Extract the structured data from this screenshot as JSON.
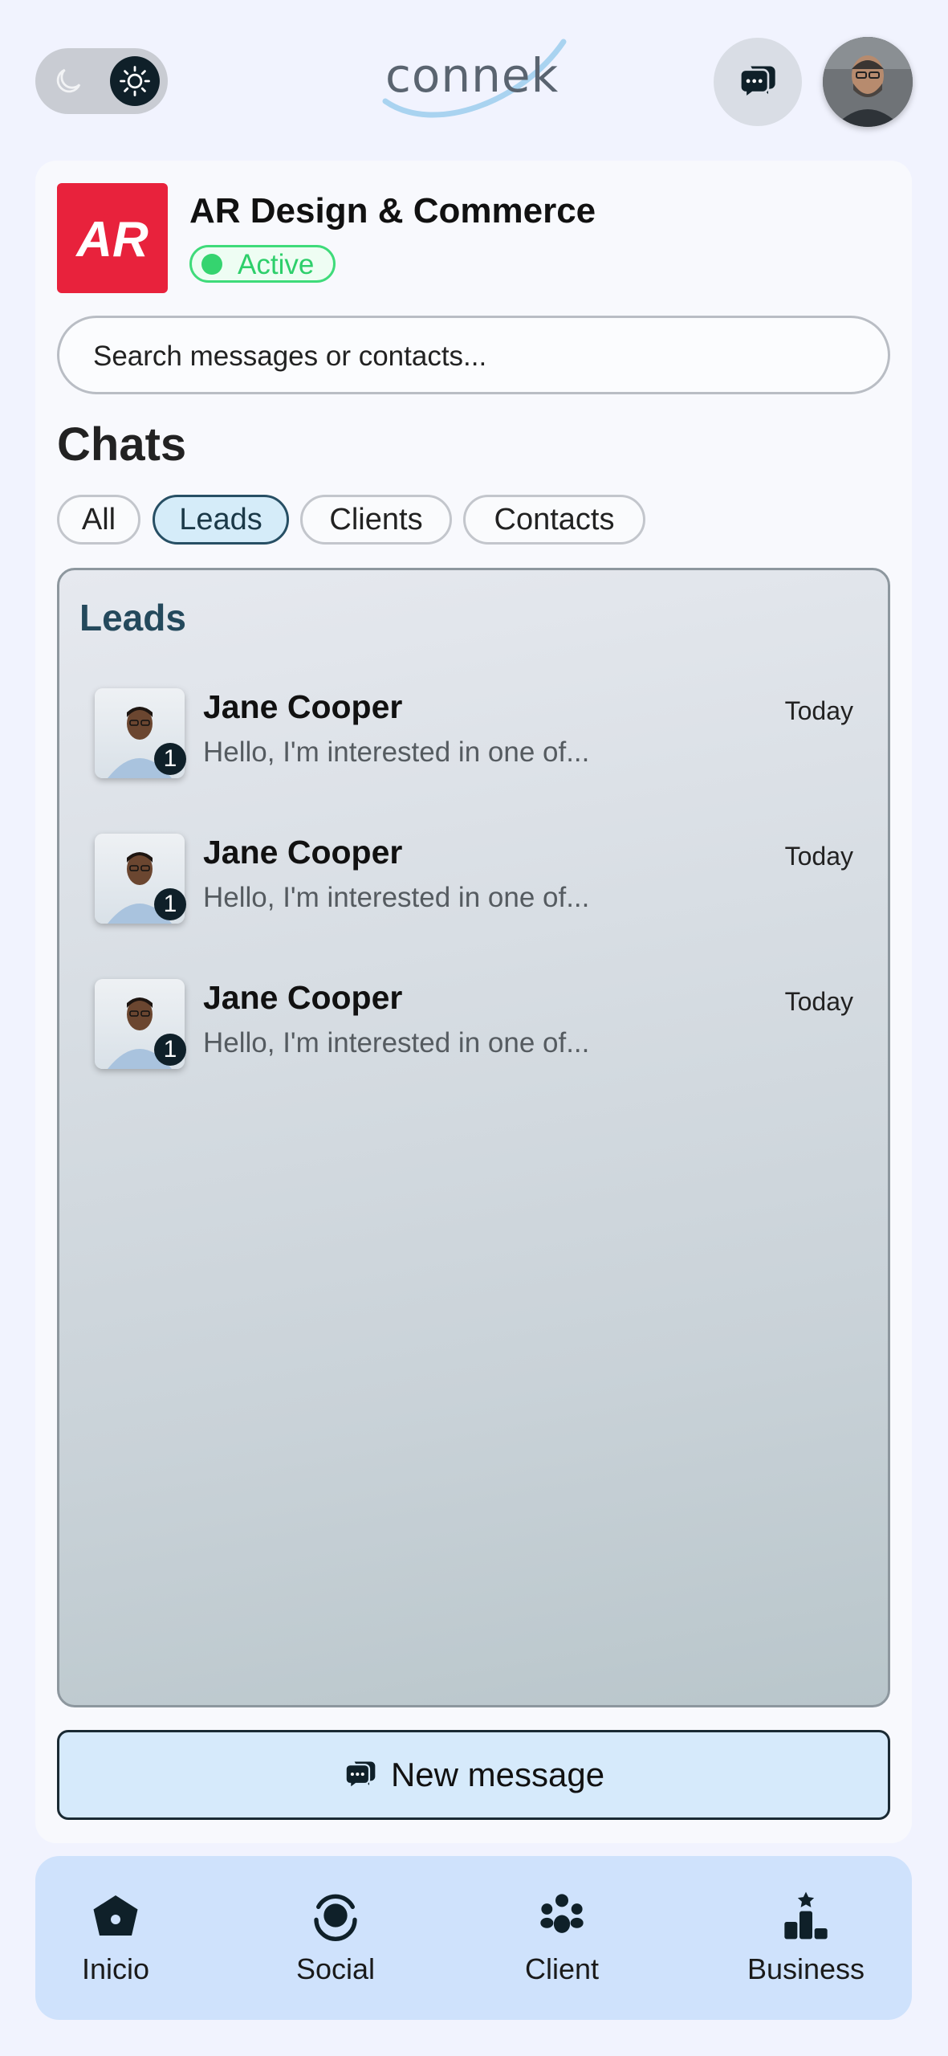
{
  "header": {
    "logo_text": "connek",
    "theme": {
      "mode": "light"
    }
  },
  "business": {
    "logo_text": "AR",
    "name": "AR Design & Commerce",
    "status": "Active",
    "status_color": "#35d46f",
    "brand_color": "#e8223c"
  },
  "search": {
    "placeholder": "Search messages or contacts..."
  },
  "chats": {
    "title": "Chats",
    "filters": [
      {
        "label": "All",
        "active": false
      },
      {
        "label": "Leads",
        "active": true
      },
      {
        "label": "Clients",
        "active": false
      },
      {
        "label": "Contacts",
        "active": false
      }
    ],
    "section_title": "Leads",
    "items": [
      {
        "name": "Jane Cooper",
        "preview": "Hello, I'm interested in one of...",
        "time": "Today",
        "unread": "1"
      },
      {
        "name": "Jane Cooper",
        "preview": "Hello, I'm interested in one of...",
        "time": "Today",
        "unread": "1"
      },
      {
        "name": "Jane Cooper",
        "preview": "Hello, I'm interested in one of...",
        "time": "Today",
        "unread": "1"
      }
    ]
  },
  "new_message": {
    "label": "New message"
  },
  "bottom_nav": {
    "items": [
      {
        "label": "Inicio",
        "icon": "home-icon"
      },
      {
        "label": "Social",
        "icon": "social-icon"
      },
      {
        "label": "Client",
        "icon": "clients-icon"
      },
      {
        "label": "Business",
        "icon": "business-icon"
      }
    ]
  }
}
